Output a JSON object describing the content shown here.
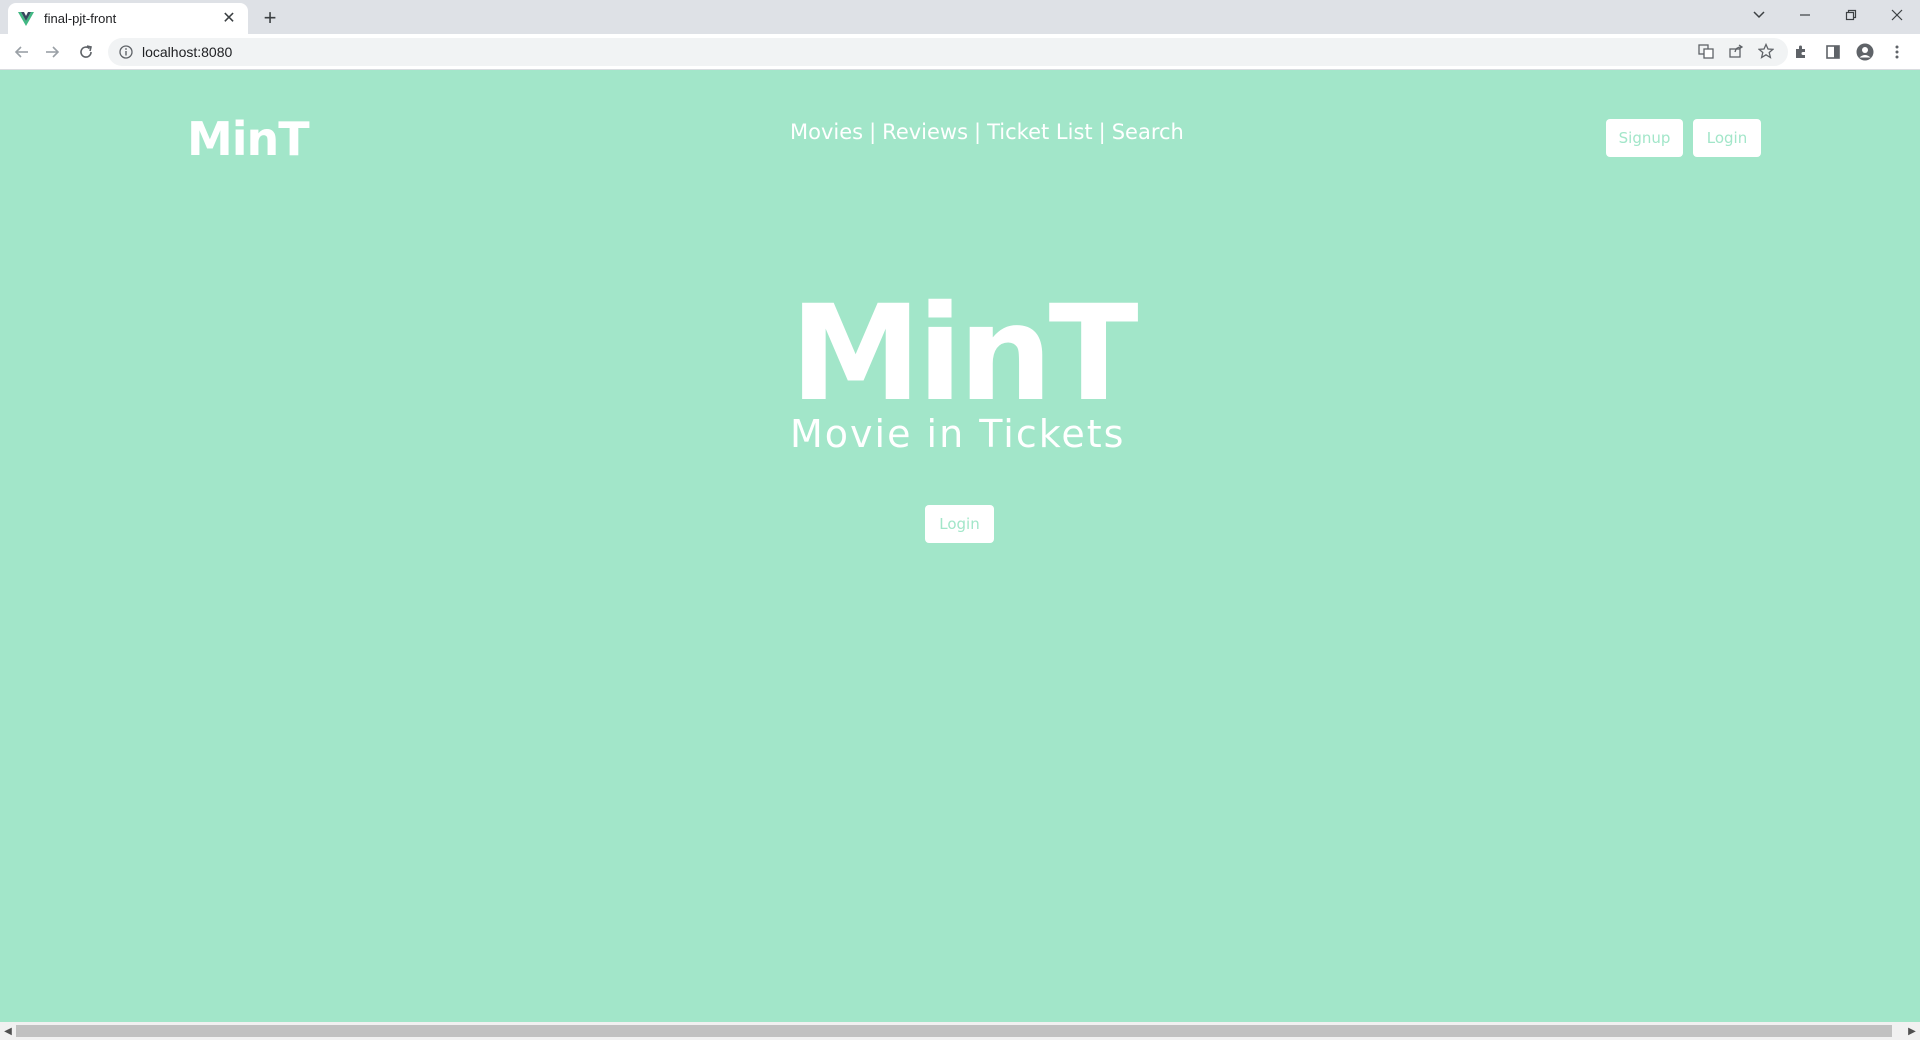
{
  "browser": {
    "tab_title": "final-pjt-front",
    "new_tab_label": "+",
    "tab_close": "✕",
    "url": "localhost:8080"
  },
  "header": {
    "logo": "MinT",
    "nav": [
      "Movies",
      "Reviews",
      "Ticket List",
      "Search"
    ],
    "separator": "|",
    "signup_label": "Signup",
    "login_label": "Login"
  },
  "hero": {
    "title": "MinT",
    "subtitle": "Movie in Tickets",
    "login_label": "Login"
  },
  "colors": {
    "background": "#a2e6c9",
    "button_bg": "#ffffff",
    "button_text": "#a2e6c9"
  }
}
